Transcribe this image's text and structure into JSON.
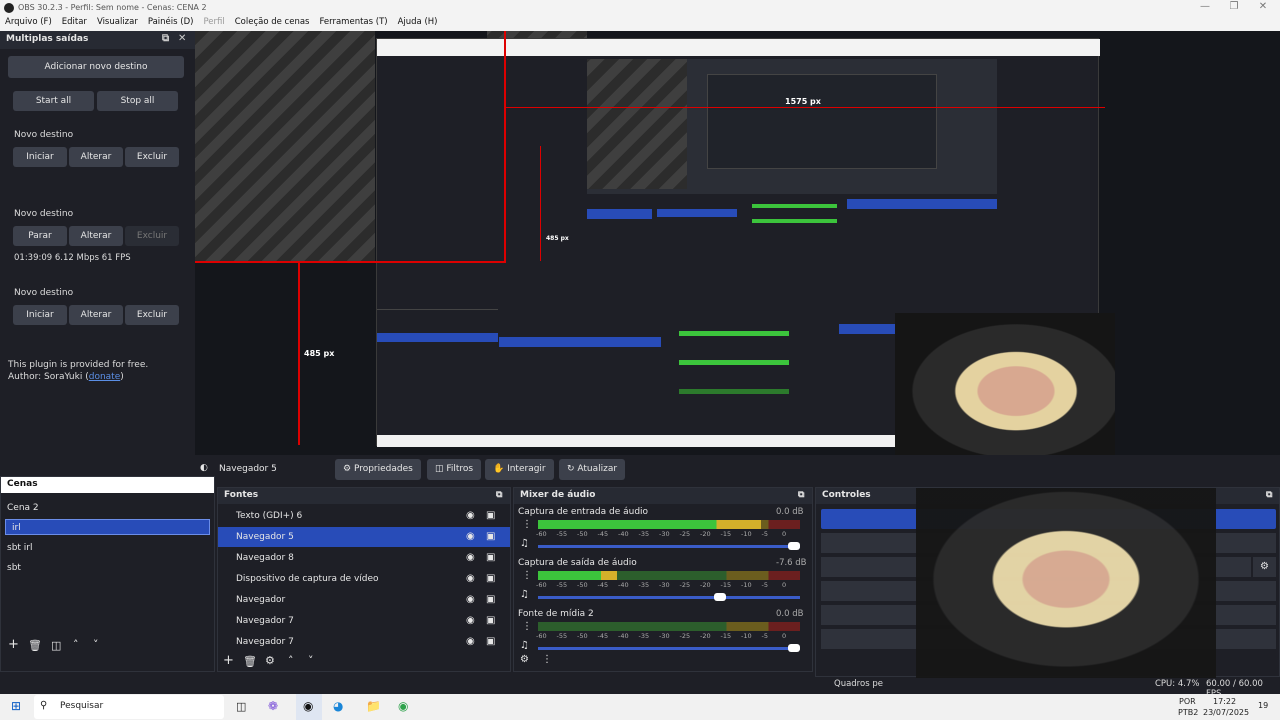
{
  "titlebar": {
    "title": "OBS 30.2.3 - Perfil: Sem nome - Cenas: CENA 2"
  },
  "menubar": {
    "items": [
      "Arquivo (F)",
      "Editar",
      "Visualizar",
      "Painéis (D)",
      "Perfil",
      "Coleção de cenas",
      "Ferramentas (T)",
      "Ajuda (H)"
    ]
  },
  "multi_output": {
    "title": "Multiplas saídas",
    "add_button": "Adicionar novo destino",
    "start_all": "Start all",
    "stop_all": "Stop all",
    "destinations": [
      {
        "name": "Novo destino",
        "b1": "Iniciar",
        "b2": "Alterar",
        "b3": "Excluir",
        "stats": ""
      },
      {
        "name": "Novo destino",
        "b1": "Parar",
        "b2": "Alterar",
        "b3": "Excluir",
        "stats": "01:39:09  6.12 Mbps  61 FPS"
      },
      {
        "name": "Novo destino",
        "b1": "Iniciar",
        "b2": "Alterar",
        "b3": "Excluir",
        "stats": ""
      }
    ],
    "footer_line1": "This plugin is provided for free.",
    "footer_author": "Author: SoraYuki (",
    "footer_link": "donate",
    "footer_end": ")"
  },
  "preview": {
    "label_1575": "1575 px",
    "label_485a": "485 px",
    "label_485b": "485 px"
  },
  "toolbar": {
    "source_name": "Navegador 5",
    "properties": "Propriedades",
    "filters": "Filtros",
    "interact": "Interagir",
    "refresh": "Atualizar"
  },
  "scenes": {
    "title": "Cenas",
    "items": [
      "Cena 2",
      "irl",
      "sbt irl",
      "sbt"
    ],
    "selected": 1
  },
  "sources": {
    "title": "Fontes",
    "items": [
      "Texto (GDI+) 6",
      "Navegador 5",
      "Navegador 8",
      "Dispositivo de captura de vídeo",
      "Navegador",
      "Navegador 7",
      "Navegador 7"
    ],
    "selected": 1
  },
  "mixer": {
    "title": "Mixer de áudio",
    "channels": [
      {
        "name": "Captura de entrada de áudio",
        "db": "0.0 dB",
        "level": 0.85
      },
      {
        "name": "Captura de saída de áudio",
        "db": "-7.6 dB",
        "level": 0.3
      },
      {
        "name": "Fonte de mídia 2",
        "db": "0.0 dB",
        "level": 0.0
      }
    ],
    "ticks": [
      "-60",
      "-55",
      "-50",
      "-45",
      "-40",
      "-35",
      "-30",
      "-25",
      "-20",
      "-15",
      "-10",
      "-5",
      "0"
    ]
  },
  "controls": {
    "title": "Controles"
  },
  "statusbar": {
    "frames": "Quadros pe",
    "cpu": "CPU: 4.7%",
    "fps": "60.00 / 60.00 FPS"
  },
  "taskbar": {
    "search": "Pesquisar",
    "lang1": "POR",
    "lang2": "PTB2",
    "time": "17:22",
    "date": "23/07/2025",
    "notif": "19"
  },
  "colors": {
    "accent": "#284cb8",
    "bg": "#1e1f26",
    "meter_green": "#3cc43c",
    "meter_yellow": "#d4b02a",
    "meter_red": "#c42a2a"
  }
}
